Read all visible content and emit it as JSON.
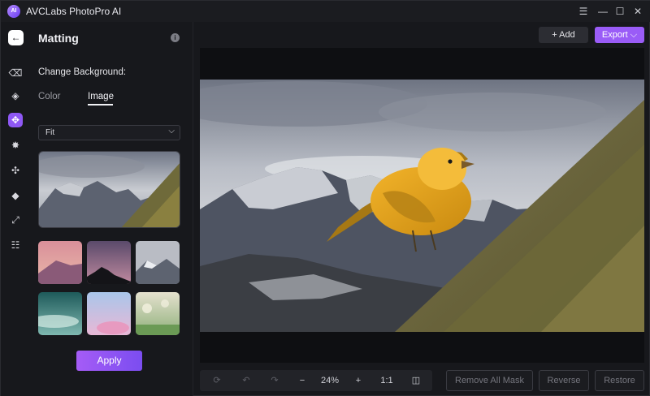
{
  "app": {
    "title": "AVCLabs PhotoPro AI",
    "logo_text": "AI"
  },
  "window_controls": {
    "menu": "☰",
    "minimize": "—",
    "maximize": "☐",
    "close": "✕"
  },
  "rail": {
    "back": "←",
    "items": [
      {
        "icon": "eraser-icon",
        "glyph": "⌫"
      },
      {
        "icon": "shapes-icon",
        "glyph": "◈"
      },
      {
        "icon": "matting-icon",
        "glyph": "✥"
      },
      {
        "icon": "sparkle-icon",
        "glyph": "✸"
      },
      {
        "icon": "fan-icon",
        "glyph": "✣"
      },
      {
        "icon": "fill-bucket-icon",
        "glyph": "◆"
      },
      {
        "icon": "resize-icon",
        "glyph": "⤢"
      },
      {
        "icon": "sliders-icon",
        "glyph": "☷"
      }
    ]
  },
  "panel": {
    "title": "Matting",
    "info": "i",
    "section_label": "Change Background:",
    "tabs": {
      "color": "Color",
      "image": "Image",
      "active": "Image"
    },
    "fit_select": {
      "value": "Fit",
      "chevron": "⌵"
    },
    "apply_label": "Apply"
  },
  "toolbar": {
    "add_label": "+ Add",
    "export_label": "Export ⌵"
  },
  "bottom": {
    "reset": "⟳",
    "undo": "↶",
    "redo": "↷",
    "zoom_out": "−",
    "zoom_level": "24%",
    "zoom_in": "+",
    "actual_size": "1:1",
    "compare": "◫",
    "remove_all_mask": "Remove All Mask",
    "reverse": "Reverse",
    "restore": "Restore"
  },
  "colors": {
    "accent": "#9a5cf7",
    "apply_gradient_start": "#a55cf6",
    "apply_gradient_end": "#7b4df0"
  }
}
